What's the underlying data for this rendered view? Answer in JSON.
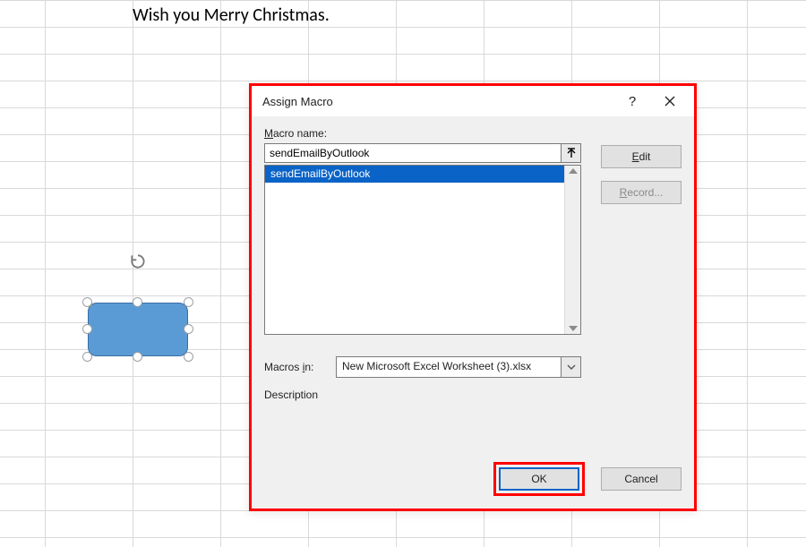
{
  "sheet": {
    "cell_text": "Wish you Merry Christmas."
  },
  "dialog": {
    "title": "Assign Macro",
    "help_glyph": "?",
    "macro_name_label_underline": "M",
    "macro_name_label_rest": "acro name:",
    "macro_name_value": "sendEmailByOutlook",
    "macro_list": [
      "sendEmailByOutlook"
    ],
    "edit_btn_underline": "E",
    "edit_btn_rest": "dit",
    "record_btn_underline": "R",
    "record_btn_rest": "ecord...",
    "macros_in_label_pre": "Macros ",
    "macros_in_label_underline": "i",
    "macros_in_label_post": "n:",
    "macros_in_value": "New Microsoft Excel Worksheet (3).xlsx",
    "description_label": "Description",
    "ok_label": "OK",
    "cancel_label": "Cancel"
  }
}
